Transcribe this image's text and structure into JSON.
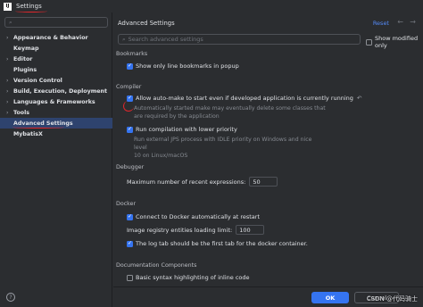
{
  "window": {
    "title": "Settings",
    "icon_label": "IJ"
  },
  "sidebar": {
    "search_placeholder": "",
    "items": [
      {
        "label": "Appearance & Behavior",
        "arrow": "›"
      },
      {
        "label": "Keymap",
        "arrow": ""
      },
      {
        "label": "Editor",
        "arrow": "›"
      },
      {
        "label": "Plugins",
        "arrow": ""
      },
      {
        "label": "Version Control",
        "arrow": "›"
      },
      {
        "label": "Build, Execution, Deployment",
        "arrow": "›"
      },
      {
        "label": "Languages & Frameworks",
        "arrow": "›"
      },
      {
        "label": "Tools",
        "arrow": "›"
      },
      {
        "label": "Advanced Settings",
        "arrow": ""
      },
      {
        "label": "MybatisX",
        "arrow": ""
      }
    ],
    "help_icon": "?"
  },
  "main": {
    "header": "Advanced Settings",
    "reset_label": "Reset",
    "back_icon": "←",
    "forward_icon": "→",
    "search_placeholder": "Search advanced settings",
    "show_modified_label": "Show modified only",
    "bookmarks": {
      "title": "Bookmarks",
      "show_only_line": "Show only line bookmarks in popup"
    },
    "compiler": {
      "title": "Compiler",
      "auto_make": "Allow auto-make to start even if developed application is currently running",
      "auto_make_desc1": "Automatically started make may eventually delete some classes that",
      "auto_make_desc2": "are required by the application",
      "low_priority": "Run compilation with lower priority",
      "low_priority_desc1": "Run external JPS process with IDLE priority on Windows and nice level",
      "low_priority_desc2": "10 on Linux/macOS"
    },
    "debugger": {
      "title": "Debugger",
      "max_recent_label": "Maximum number of recent expressions:",
      "max_recent_value": "50"
    },
    "docker": {
      "title": "Docker",
      "connect_auto": "Connect to Docker automatically at restart",
      "image_registry_label": "Image registry entities loading limit:",
      "image_registry_value": "100",
      "log_tab_first": "The log tab should be the first tab for the docker container."
    },
    "documentation": {
      "title": "Documentation Components",
      "basic_syntax": "Basic syntax highlighting of inline code"
    }
  },
  "footer": {
    "ok_label": "OK",
    "cancel_label": "Cancel",
    "watermark": "CSDN @代码骑士"
  },
  "colors": {
    "background": "#2b2d30",
    "accent": "#3574f0",
    "selection": "#2e436e",
    "link": "#548af7"
  }
}
